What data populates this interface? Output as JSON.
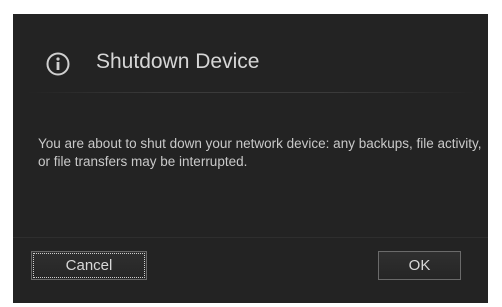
{
  "dialog": {
    "title": "Shutdown Device",
    "icon": "info-icon",
    "message": "You are about to shut down your network device: any backups, file activity, or file transfers may be interrupted.",
    "buttons": {
      "cancel_label": "Cancel",
      "ok_label": "OK"
    }
  },
  "colors": {
    "background": "#232323",
    "text": "#c9c9c9",
    "title": "#d6d6d6",
    "button_border": "#6a6a6a"
  }
}
